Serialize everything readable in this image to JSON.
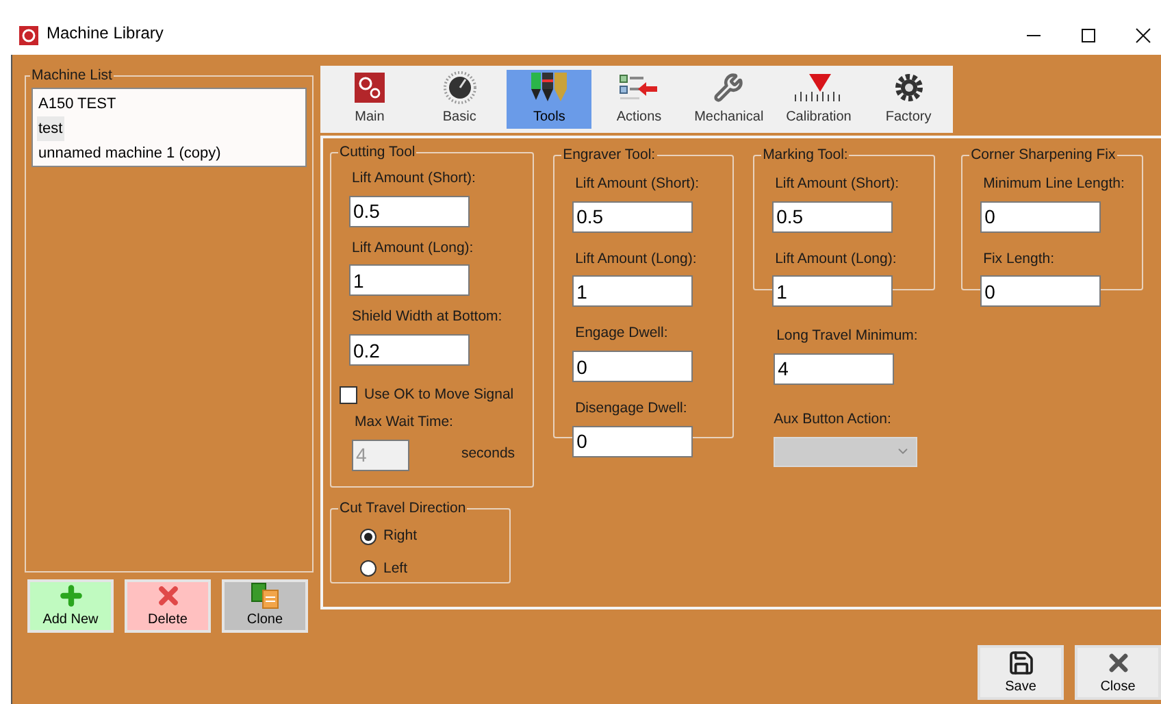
{
  "window": {
    "title": "Machine Library"
  },
  "machine_list": {
    "label": "Machine List",
    "items": [
      {
        "label": "A150 TEST",
        "selected": false
      },
      {
        "label": "test",
        "selected": true
      },
      {
        "label": "unnamed machine 1 (copy)",
        "selected": false
      }
    ]
  },
  "list_buttons": [
    {
      "label": "Add New",
      "kind": "add"
    },
    {
      "label": "Delete",
      "kind": "delete"
    },
    {
      "label": "Clone",
      "kind": "clone"
    }
  ],
  "tabs": [
    {
      "label": "Main",
      "kind": "main",
      "selected": false
    },
    {
      "label": "Basic",
      "kind": "basic",
      "selected": false
    },
    {
      "label": "Tools",
      "kind": "tools",
      "selected": true
    },
    {
      "label": "Actions",
      "kind": "actions",
      "selected": false
    },
    {
      "label": "Mechanical",
      "kind": "mechanical",
      "selected": false
    },
    {
      "label": "Calibration",
      "kind": "calibration",
      "selected": false
    },
    {
      "label": "Factory",
      "kind": "factory",
      "selected": false
    }
  ],
  "cutting_tool": {
    "label": "Cutting Tool",
    "fields": [
      {
        "label": "Lift Amount (Short):",
        "value": "0.5"
      },
      {
        "label": "Lift Amount (Long):",
        "value": "1"
      },
      {
        "label": "Shield Width at Bottom:",
        "value": "0.2"
      }
    ],
    "signal_checkbox": {
      "label": "Use OK to Move Signal",
      "checked": false
    },
    "max_wait": {
      "label": "Max Wait Time:",
      "value": "4",
      "disabled": true,
      "unit": "seconds"
    }
  },
  "cut_travel_direction": {
    "label": "Cut Travel Direction",
    "options": [
      {
        "label": "Right",
        "selected": true
      },
      {
        "label": "Left",
        "selected": false
      }
    ]
  },
  "engraver_tool": {
    "label": "Engraver Tool:",
    "fields": [
      {
        "label": "Lift Amount (Short):",
        "value": "0.5"
      },
      {
        "label": "Lift Amount (Long):",
        "value": "1"
      },
      {
        "label": "Engage Dwell:",
        "value": "0"
      },
      {
        "label": "Disengage Dwell:",
        "value": "0"
      }
    ]
  },
  "marking_tool": {
    "label": "Marking Tool:",
    "fields": [
      {
        "label": "Lift Amount (Short):",
        "value": "0.5"
      },
      {
        "label": "Lift Amount (Long):",
        "value": "1"
      }
    ]
  },
  "corner_sharpening": {
    "label": "Corner Sharpening Fix",
    "fields": [
      {
        "label": "Minimum Line Length:",
        "value": "0"
      },
      {
        "label": "Fix Length:",
        "value": "0"
      }
    ]
  },
  "long_travel_minimum": {
    "label": "Long Travel Minimum:",
    "value": "4"
  },
  "aux_button_action": {
    "label": "Aux Button Action:",
    "disabled": true
  },
  "footer_buttons": [
    {
      "label": "Save",
      "kind": "save"
    },
    {
      "label": "Close",
      "kind": "close"
    }
  ]
}
